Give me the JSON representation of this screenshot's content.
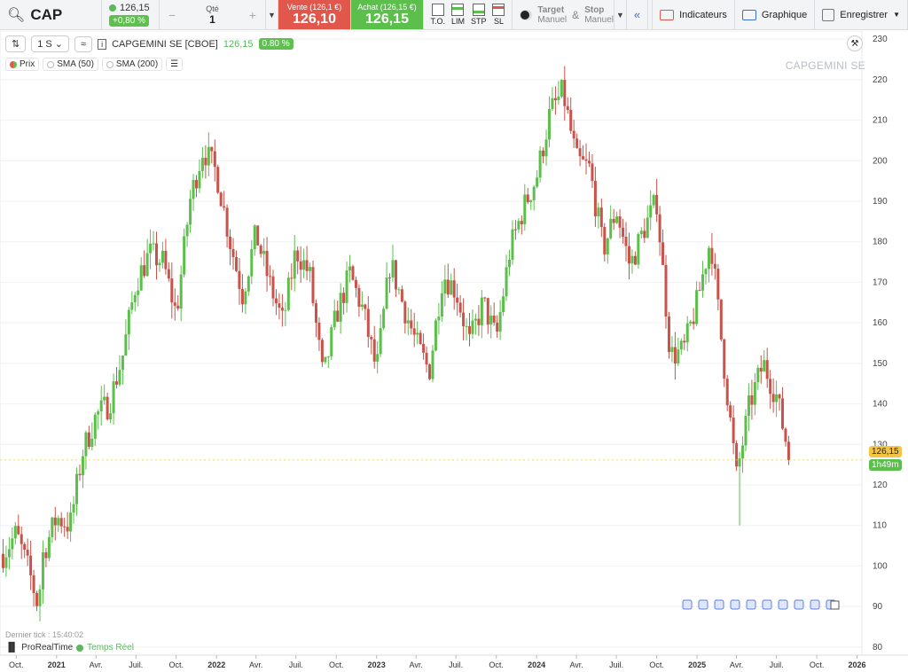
{
  "topbar": {
    "ticker": "CAP",
    "last_price": "126,15",
    "change_pct": "+0,80 %",
    "qty_label": "Qté",
    "qty_value": "1",
    "sell_label": "Vente (126,1 €)",
    "sell_value": "126,10",
    "buy_label": "Achat (126,15 €)",
    "buy_value": "126,15",
    "order_types": [
      "T.O.",
      "LIM",
      "STP",
      "SL"
    ],
    "target_label": "Target",
    "target_sub": "Manuel",
    "amp": "&",
    "stop_label": "Stop",
    "stop_sub": "Manuel",
    "indicators_label": "Indicateurs",
    "graphique_label": "Graphique",
    "enregistrer_label": "Enregistrer",
    "colors": {
      "sell": "#e2574c",
      "buy": "#5cbf4c"
    }
  },
  "chart_header": {
    "interval": "1 S",
    "instrument": "CAPGEMINI SE [CBOE]",
    "price": "126,15",
    "change": "0.80 %",
    "indicators": [
      "Prix",
      "SMA (50)",
      "SMA (200)"
    ],
    "watermark": "CAPGEMINI SE"
  },
  "footer": {
    "last_tick": "Dernier tick : 15:40:02",
    "brand": "ProRealTime",
    "realtime": "Temps Réel",
    "price_badge": "126,15",
    "time_badge": "1h49m"
  },
  "chart_data": {
    "type": "candlestick",
    "title": "",
    "xlabel": "",
    "ylabel": "",
    "ylim": [
      78,
      232
    ],
    "yticks": [
      80,
      90,
      100,
      110,
      120,
      130,
      140,
      150,
      160,
      170,
      180,
      190,
      200,
      210,
      220,
      230
    ],
    "xtick_labels": [
      "Oct.",
      "2021",
      "Avr.",
      "Juil.",
      "Oct.",
      "2022",
      "Avr.",
      "Juil.",
      "Oct.",
      "2023",
      "Avr.",
      "Juil.",
      "Oct.",
      "2024",
      "Avr.",
      "Juil.",
      "Oct.",
      "2025",
      "Avr.",
      "Juil.",
      "Oct.",
      "2026"
    ],
    "xtick_dates": [
      "2020-10",
      "2021-01",
      "2021-04",
      "2021-07",
      "2021-10",
      "2022-01",
      "2022-04",
      "2022-07",
      "2022-10",
      "2023-01",
      "2023-04",
      "2023-07",
      "2023-10",
      "2024-01",
      "2024-04",
      "2024-07",
      "2024-10",
      "2025-01",
      "2025-04",
      "2025-07",
      "2025-10",
      "2026-01"
    ],
    "bold_ticks": [
      "2021",
      "2022",
      "2023",
      "2024",
      "2025",
      "2026"
    ],
    "close_path": [
      [
        "2020-09",
        103
      ],
      [
        "2020-10",
        108
      ],
      [
        "2020-11",
        98
      ],
      [
        "2020-11-20",
        90
      ],
      [
        "2020-12",
        103
      ],
      [
        "2021-01",
        112
      ],
      [
        "2021-02",
        110
      ],
      [
        "2021-03",
        128
      ],
      [
        "2021-04",
        137
      ],
      [
        "2021-05",
        140
      ],
      [
        "2021-06",
        152
      ],
      [
        "2021-07",
        170
      ],
      [
        "2021-08",
        177
      ],
      [
        "2021-09",
        175
      ],
      [
        "2021-10",
        162
      ],
      [
        "2021-11",
        190
      ],
      [
        "2021-12",
        203
      ],
      [
        "2022-01",
        197
      ],
      [
        "2022-02",
        180
      ],
      [
        "2022-03",
        167
      ],
      [
        "2022-04",
        182
      ],
      [
        "2022-05",
        170
      ],
      [
        "2022-06",
        160
      ],
      [
        "2022-07",
        178
      ],
      [
        "2022-08",
        172
      ],
      [
        "2022-09",
        146
      ],
      [
        "2022-10",
        162
      ],
      [
        "2022-11",
        172
      ],
      [
        "2022-12",
        163
      ],
      [
        "2023-01",
        148
      ],
      [
        "2023-02",
        175
      ],
      [
        "2023-03",
        165
      ],
      [
        "2023-04",
        155
      ],
      [
        "2023-05",
        148
      ],
      [
        "2023-06",
        172
      ],
      [
        "2023-07",
        168
      ],
      [
        "2023-08",
        155
      ],
      [
        "2023-09",
        165
      ],
      [
        "2023-10",
        156
      ],
      [
        "2023-11",
        178
      ],
      [
        "2023-12",
        188
      ],
      [
        "2024-01",
        196
      ],
      [
        "2024-02",
        212
      ],
      [
        "2024-03",
        217
      ],
      [
        "2024-04",
        200
      ],
      [
        "2024-05",
        198
      ],
      [
        "2024-06",
        178
      ],
      [
        "2024-07",
        188
      ],
      [
        "2024-08",
        174
      ],
      [
        "2024-09",
        183
      ],
      [
        "2024-10",
        190
      ],
      [
        "2024-11",
        152
      ],
      [
        "2024-12",
        153
      ],
      [
        "2025-01",
        165
      ],
      [
        "2025-02",
        181
      ],
      [
        "2025-03",
        152
      ],
      [
        "2025-04",
        122
      ],
      [
        "2025-05",
        140
      ],
      [
        "2025-06",
        150
      ],
      [
        "2025-07",
        142
      ],
      [
        "2025-08",
        126.15
      ]
    ],
    "low_marker": [
      "2025-04-07",
      110
    ],
    "last_value": 126.15,
    "grid": true,
    "colors": {
      "up": "#5cbf4c",
      "down": "#c9524a"
    }
  }
}
